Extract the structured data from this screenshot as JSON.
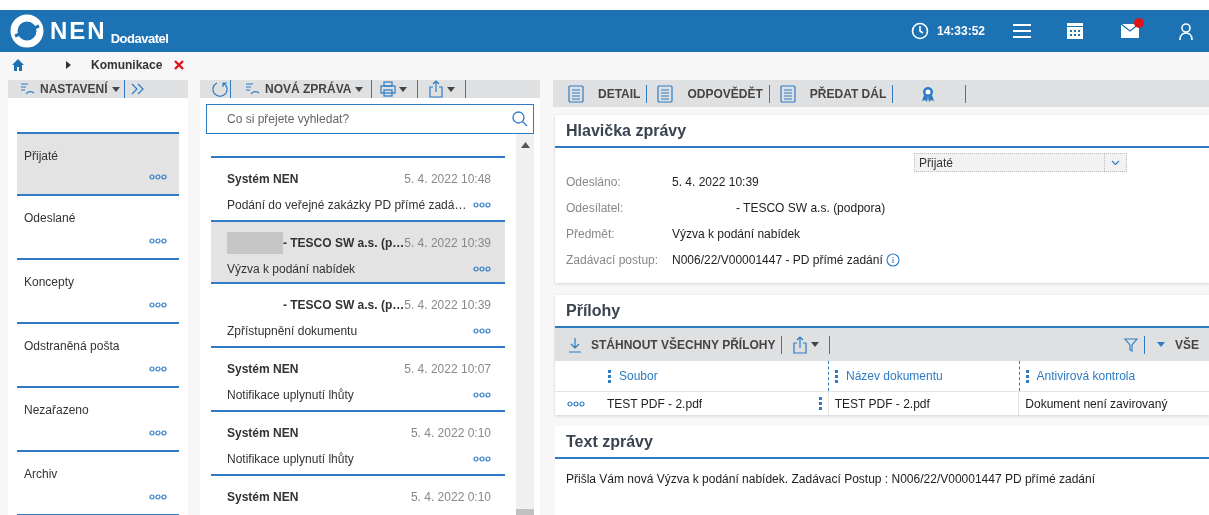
{
  "header": {
    "logo": "NEN",
    "logo_sub": "Dodavatel",
    "time": "14:33:52",
    "mail_unread": true
  },
  "breadcrumb": {
    "items": [
      "Komunikace"
    ]
  },
  "folders_toolbar": {
    "settings": "NASTAVENÍ"
  },
  "folders": [
    {
      "label": "Přijaté",
      "selected": true
    },
    {
      "label": "Odeslané",
      "selected": false
    },
    {
      "label": "Koncepty",
      "selected": false
    },
    {
      "label": "Odstraněná pošta",
      "selected": false
    },
    {
      "label": "Nezařazeno",
      "selected": false
    },
    {
      "label": "Archiv",
      "selected": false
    }
  ],
  "messages_toolbar": {
    "new_message": "NOVÁ ZPRÁVA"
  },
  "search": {
    "placeholder": "Co si přejete vyhledat?"
  },
  "messages": [
    {
      "sender": "Systém NEN",
      "redacted": false,
      "date": "5. 4. 2022 10:48",
      "subject": "Podání do veřejné zakázky PD přímé zadá…",
      "selected": false
    },
    {
      "sender": "- TESCO SW a.s. (p…",
      "redacted": true,
      "date": "5. 4. 2022 10:39",
      "subject": "Výzva k podání nabídek",
      "selected": true
    },
    {
      "sender": "- TESCO SW a.s. (p…",
      "redacted": false,
      "date": "5. 4. 2022 10:39",
      "subject": "Zpřístupnění dokumentu",
      "selected": false
    },
    {
      "sender": "Systém NEN",
      "redacted": false,
      "date": "5. 4. 2022 10:07",
      "subject": "Notifikace uplynutí lhůty",
      "selected": false
    },
    {
      "sender": "Systém NEN",
      "redacted": false,
      "date": "5. 4. 2022 0:10",
      "subject": "Notifikace uplynutí lhůty",
      "selected": false
    },
    {
      "sender": "Systém NEN",
      "redacted": false,
      "date": "5. 4. 2022 0:10",
      "selected": false
    }
  ],
  "detail_toolbar": [
    "DETAIL",
    "ODPOVĚDĚT",
    "PŘEDAT DÁL"
  ],
  "header_section": {
    "title": "Hlavička zprávy",
    "folder_select": "Přijaté",
    "fields": [
      {
        "label": "Odesláno:",
        "value": "5. 4. 2022 10:39",
        "info": false
      },
      {
        "label": "Odesílatel:",
        "value": "- TESCO SW a.s. (podpora)",
        "info": false
      },
      {
        "label": "Předmět:",
        "value": "Výzva k podání nabídek",
        "info": false
      },
      {
        "label": "Zadávací postup:",
        "value": "N006/22/V00001447 - PD přímé zadání",
        "info": true
      }
    ]
  },
  "attachments": {
    "title": "Přílohy",
    "download_all": "STÁHNOUT VŠECHNY PŘÍLOHY",
    "filter_label": "VŠE",
    "columns": [
      "Soubor",
      "Název dokumentu",
      "Antivirová kontrola"
    ],
    "rows": [
      [
        "TEST PDF - 2.pdf",
        "TEST PDF - 2.pdf",
        "Dokument není zavirovaný"
      ]
    ]
  },
  "message_text": {
    "title": "Text zprávy",
    "body": "Přišla Vám nová Výzva k podání nabídek. Zadávací Postup : N006/22/V00001447 PD přímé zadání"
  }
}
